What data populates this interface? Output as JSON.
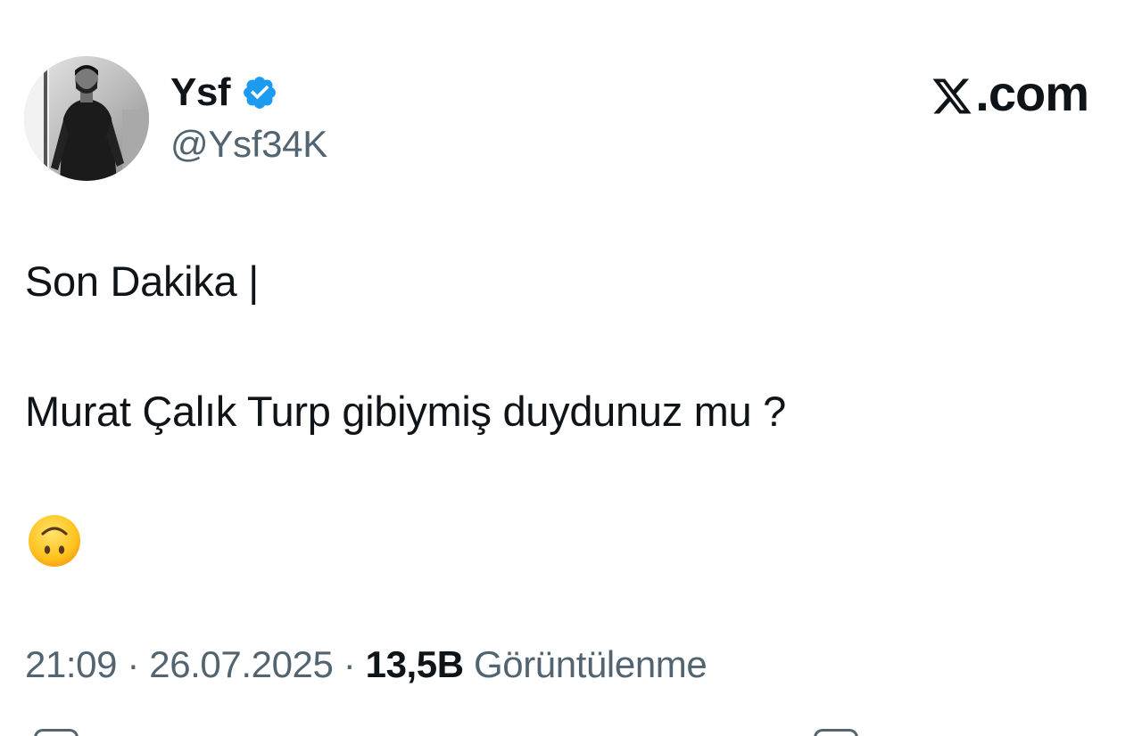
{
  "author": {
    "display_name": "Ysf",
    "handle": "@Ysf34K",
    "verified": true,
    "verified_badge_icon": "verified-badge-icon",
    "avatar_icon": "profile-photo"
  },
  "brand": {
    "logo_icon": "x-logo-icon",
    "suffix": ".com"
  },
  "tweet": {
    "line1": "Son Dakika |",
    "line2": "Murat Çalık Turp gibiymiş duydunuz mu ?",
    "emoji_icon": "upside-down-face-emoji"
  },
  "meta": {
    "time": "21:09",
    "separator": "·",
    "date": "26.07.2025",
    "views_count": "13,5B",
    "views_label": "Görüntülenme"
  },
  "colors": {
    "text_primary": "#0f1419",
    "text_secondary": "#536471",
    "verified_blue": "#1d9bf0",
    "background": "#ffffff"
  }
}
